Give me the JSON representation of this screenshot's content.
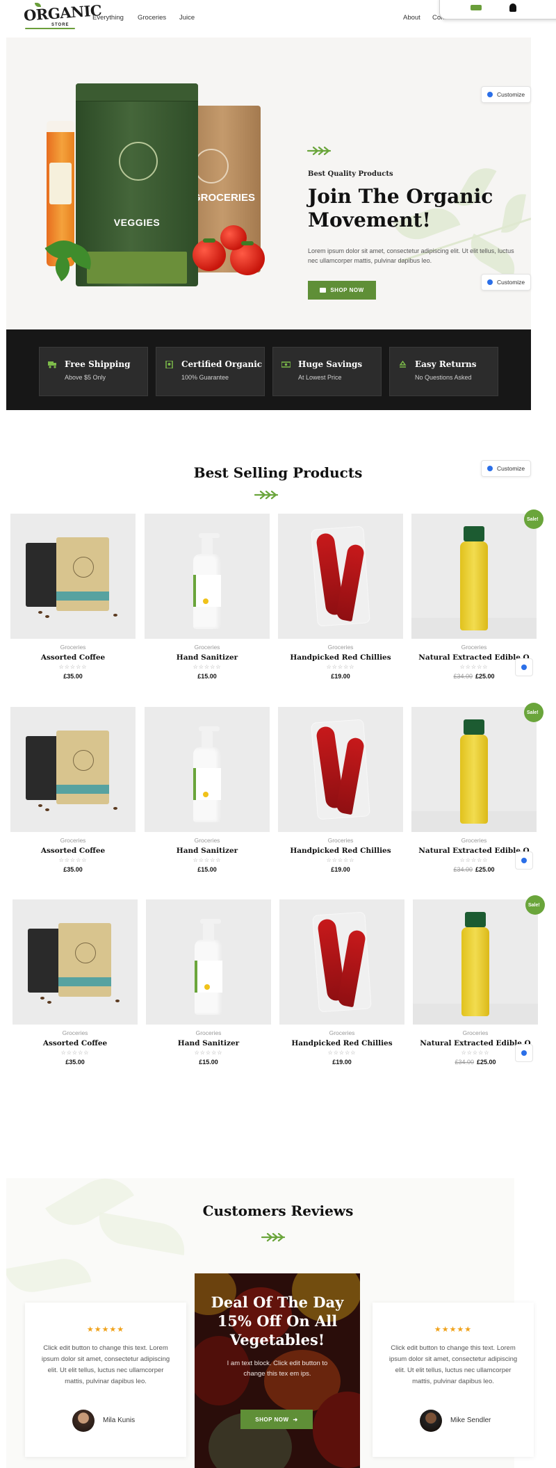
{
  "brand": {
    "logo_word": "ORGANIC",
    "logo_sub": "STORE"
  },
  "nav": {
    "left": [
      "Everything",
      "Groceries",
      "Juice"
    ],
    "right": [
      "About",
      "Contact"
    ]
  },
  "hero": {
    "kicker": "Best Quality Products",
    "title": "Join The Organic Movement!",
    "body": "Lorem ipsum dolor sit amet, consectetur adipiscing elit. Ut elit tellus, luctus nec ullamcorper mattis, pulvinar dapibus leo.",
    "button": "SHOP NOW",
    "bag_green_label": "VEGGIES",
    "bag_kraft_label": "GROCERIES"
  },
  "customize_label": "Customize",
  "features": [
    {
      "title": "Free Shipping",
      "subtitle": "Above $5 Only",
      "icon": "truck-icon"
    },
    {
      "title": "Certified Organic",
      "subtitle": "100% Guarantee",
      "icon": "badge-icon"
    },
    {
      "title": "Huge Savings",
      "subtitle": "At Lowest Price",
      "icon": "money-icon"
    },
    {
      "title": "Easy Returns",
      "subtitle": "No Questions Asked",
      "icon": "recycle-icon"
    }
  ],
  "best_selling": {
    "title": "Best Selling Products",
    "sale_badge": "Sale!",
    "products": [
      {
        "category": "Groceries",
        "name": "Assorted Coffee",
        "price": "£35.00",
        "old_price": "",
        "image": "coffee"
      },
      {
        "category": "Groceries",
        "name": "Hand Sanitizer",
        "price": "£15.00",
        "old_price": "",
        "image": "sanitizer"
      },
      {
        "category": "Groceries",
        "name": "Handpicked Red Chillies",
        "price": "£19.00",
        "old_price": "",
        "image": "chillies"
      },
      {
        "category": "Groceries",
        "name": "Natural Extracted Edible O",
        "price": "£25.00",
        "old_price": "£34.00",
        "image": "oil"
      }
    ],
    "rating_stars": "☆☆☆☆☆"
  },
  "reviews": {
    "title": "Customers Reviews",
    "stars": "★★★★★",
    "items": [
      {
        "text": "Click edit button to change this text. Lorem ipsum dolor sit amet, consectetur adipiscing elit. Ut elit tellus, luctus nec ullamcorper mattis, pulvinar dapibus leo.",
        "name": "Mila Kunis"
      },
      {
        "text": "Click edit button to change this text. Lorem ipsum dolor sit amet, consectetur adipiscing elit. Ut elit tellus, luctus nec ullamcorper mattis, pulvinar dapibus leo.",
        "name": "Mike Sendler"
      }
    ]
  },
  "deal": {
    "title": "Deal Of The Day 15% Off On All Vegetables!",
    "text": "I am text block. Click edit button to change this tex em ips.",
    "button": "SHOP NOW"
  },
  "colors": {
    "accent": "#5f8f37",
    "dark": "#171717",
    "star": "#f0a21a"
  }
}
